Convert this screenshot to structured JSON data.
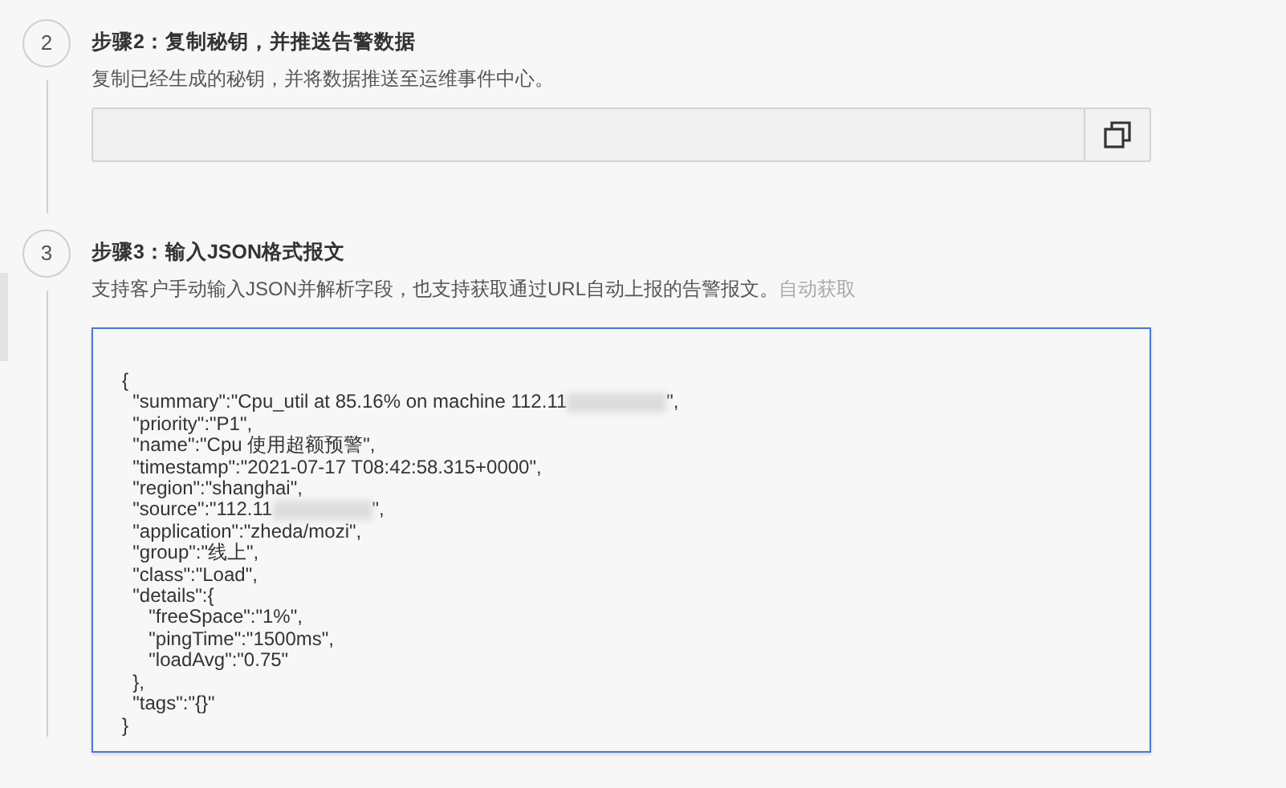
{
  "steps": [
    {
      "number": "2",
      "title": "步骤2：复制秘钥，并推送告警数据",
      "description": "复制已经生成的秘钥，并将数据推送至运维事件中心。",
      "kind": "secret"
    },
    {
      "number": "3",
      "title": "步骤3：输入JSON格式报文",
      "description": "支持客户手动输入JSON并解析字段，也支持获取通过URL自动上报的告警报文。",
      "link": "自动获取",
      "kind": "json",
      "lines": [
        {
          "text": "{"
        },
        {
          "text": "  \"summary\":\"Cpu_util at 85.16% on machine 112.11",
          "redacted": true,
          "tail": "\","
        },
        {
          "text": "  \"priority\":\"P1\","
        },
        {
          "text": "  \"name\":\"Cpu 使用超额预警\","
        },
        {
          "text": "  \"timestamp\":\"2021-07-17 T08:42:58.315+0000\","
        },
        {
          "text": "  \"region\":\"shanghai\","
        },
        {
          "text": "  \"source\":\"112.11",
          "redacted": true,
          "tail": "\","
        },
        {
          "text": "  \"application\":\"zheda/mozi\","
        },
        {
          "text": "  \"group\":\"线上\","
        },
        {
          "text": "  \"class\":\"Load\","
        },
        {
          "text": "  \"details\":{"
        },
        {
          "text": "     \"freeSpace\":\"1%\","
        },
        {
          "text": "     \"pingTime\":\"1500ms\","
        },
        {
          "text": "     \"loadAvg\":\"0.75\""
        },
        {
          "text": "  },"
        },
        {
          "text": "  \"tags\":\"{}\""
        },
        {
          "text": "}"
        }
      ]
    }
  ]
}
